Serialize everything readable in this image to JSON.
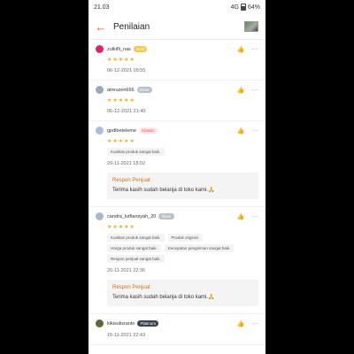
{
  "status": {
    "time": "21.03",
    "network": "4G",
    "battery": "64%"
  },
  "header": {
    "title": "Penilaian"
  },
  "reviews": [
    {
      "username": "zulkifli_nas",
      "badge": "Gold",
      "badge_bg": "#f2c94c",
      "badge_fg": "#ffffff",
      "avatar_color": "#e0245e",
      "stars": "★★★★★",
      "date": "06-12-2021 09:55",
      "tags": []
    },
    {
      "username": "atreuzen666",
      "badge": "Silver",
      "badge_bg": "#b8c0cc",
      "badge_fg": "#ffffff",
      "avatar_color": "#9aa8c2",
      "stars": "★★★★★",
      "date": "06-12-2021 21:40",
      "tags": []
    },
    {
      "username": "gpdibeteleme",
      "badge": "Classic",
      "badge_bg": "#fde9e7",
      "badge_fg": "#e8473b",
      "avatar_color": "#a7c0d8",
      "stars": "★★★★★",
      "tags": [
        "Kualitas produk sangat baik."
      ],
      "date": "29-11-2021 18:02",
      "response": {
        "title": "Respon Penjual:",
        "text": "Terima kasih sudah belanja di toko kami.🙏"
      }
    },
    {
      "username": "candra_lutfiansyah_20",
      "badge": "Silver",
      "badge_bg": "#b8c0cc",
      "badge_fg": "#ffffff",
      "avatar_color": "#a7b8cc",
      "stars": "★★★★★",
      "tags": [
        "Kualitas produk sangat baik.",
        "Produk original.",
        "Harga produk sangat baik.",
        "Kecepatan pengiriman sangat baik.",
        "Respon penjual sangat baik."
      ],
      "date": "20-11-2021 22:36",
      "response": {
        "title": "Respon Penjual:",
        "text": "Terima kasih sudah belanja di toko kami.🙏"
      }
    },
    {
      "username": "kikisulisranto",
      "badge": "Platinum",
      "badge_bg": "#3b4250",
      "badge_fg": "#ffffff",
      "avatar_color": "#5a6b3a",
      "stars": "",
      "date": "15-11-2021 22:43",
      "tags": []
    }
  ]
}
